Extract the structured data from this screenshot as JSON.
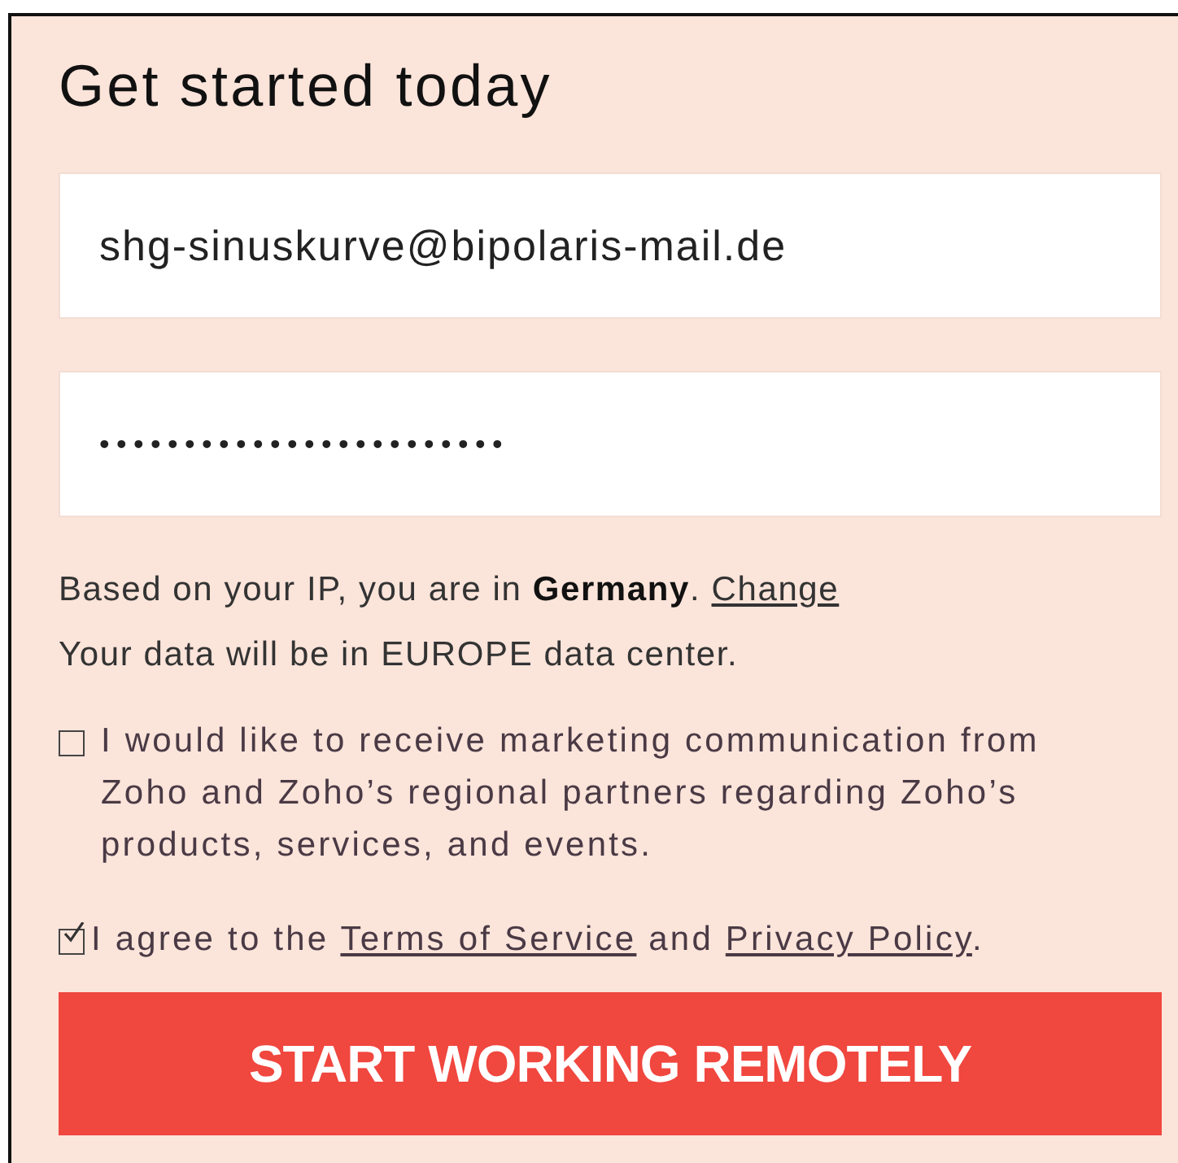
{
  "heading": "Get started today",
  "fields": [
    {
      "kind": "email",
      "value": "shg-sinuskurve@bipolaris-mail.de"
    },
    {
      "kind": "password",
      "value": "••••••••••••••••••••••••"
    }
  ],
  "location_note": {
    "text": "Based on your IP, you are in **Germany**.",
    "link": "Change"
  },
  "data_center_note": "Your data will be in EUROPE data center.",
  "consents": [
    {
      "text": "I would like to receive marketing communication from Zoho and Zoho’s regional partners regarding Zoho’s products, services, and events.",
      "checked": false
    },
    {
      "parts": [
        {
          "text": "I agree to the "
        },
        {
          "text": "Terms of Service",
          "link": true
        },
        {
          "text": " and "
        },
        {
          "text": "Privacy Policy",
          "link": true
        },
        {
          "text": "."
        }
      ],
      "checked": true
    }
  ],
  "submit_button": "START WORKING REMOTELY"
}
